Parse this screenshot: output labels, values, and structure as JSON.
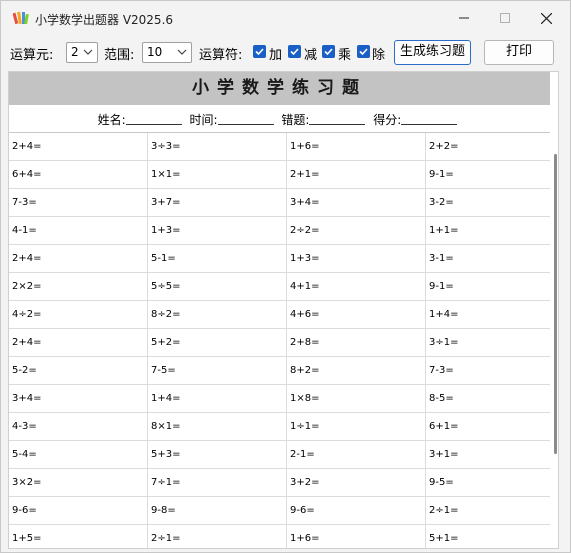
{
  "window": {
    "title": "小学数学出题器 V2025.6"
  },
  "toolbar": {
    "operands_label": "运算元:",
    "operands_value": "2",
    "range_label": "范围:",
    "range_value": "10",
    "operators_label": "运算符:",
    "op_add": "加",
    "op_sub": "减",
    "op_mul": "乘",
    "op_div": "除",
    "generate_label": "生成练习题",
    "print_label": "打印"
  },
  "sheet": {
    "title": "小学数学练习题",
    "name_label": "姓名:",
    "time_label": "时间:",
    "errors_label": "错题:",
    "score_label": "得分:",
    "rows": [
      [
        "2+4=",
        "3÷3=",
        "1+6=",
        "2+2="
      ],
      [
        "6+4=",
        "1×1=",
        "2+1=",
        "9-1="
      ],
      [
        "7-3=",
        "3+7=",
        "3+4=",
        "3-2="
      ],
      [
        "4-1=",
        "1+3=",
        "2÷2=",
        "1+1="
      ],
      [
        "2+4=",
        "5-1=",
        "1+3=",
        "3-1="
      ],
      [
        "2×2=",
        "5÷5=",
        "4+1=",
        "9-1="
      ],
      [
        "4÷2=",
        "8÷2=",
        "4+6=",
        "1+4="
      ],
      [
        "2+4=",
        "5+2=",
        "2+8=",
        "3÷1="
      ],
      [
        "5-2=",
        "7-5=",
        "8+2=",
        "7-3="
      ],
      [
        "3+4=",
        "1+4=",
        "1×8=",
        "8-5="
      ],
      [
        "4-3=",
        "8×1=",
        "1÷1=",
        "6+1="
      ],
      [
        "5-4=",
        "5+3=",
        "2-1=",
        "3+1="
      ],
      [
        "3×2=",
        "7÷1=",
        "3+2=",
        "9-5="
      ],
      [
        "9-6=",
        "9-8=",
        "9-6=",
        "2÷1="
      ],
      [
        "1+5=",
        "2÷1=",
        "1+6=",
        "5+1="
      ]
    ]
  }
}
